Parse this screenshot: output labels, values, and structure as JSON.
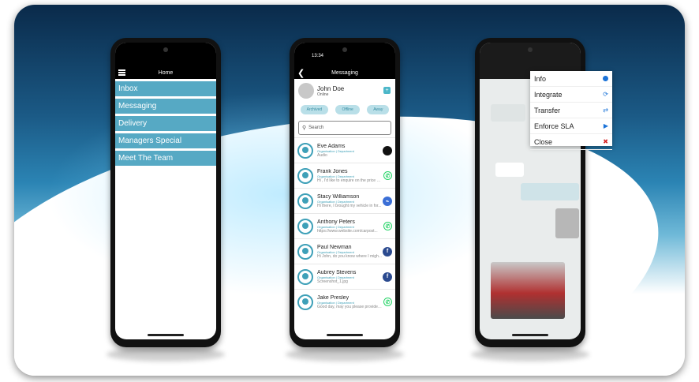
{
  "phone1": {
    "title": "Home",
    "menu": [
      "Inbox",
      "Messaging",
      "Delivery",
      "Managers Special",
      "Meet The Team"
    ]
  },
  "phone2": {
    "time": "13:34",
    "title": "Messaging",
    "contact": {
      "name": "John Doe",
      "status": "Online"
    },
    "filters": [
      "Archived",
      "Offline",
      "Away"
    ],
    "search_placeholder": "Search",
    "chats": [
      {
        "name": "Eve Adams",
        "org": "Organisation | Department",
        "last": "Audio",
        "channel": "black"
      },
      {
        "name": "Frank Jones",
        "org": "Organisation | Department",
        "last": "Hi , I'd like to enquire on the price o...",
        "channel": "whatsapp"
      },
      {
        "name": "Stacy Williamson",
        "org": "Organisation | Department",
        "last": "Hi there, I brought my vehicle in for...",
        "channel": "messenger"
      },
      {
        "name": "Anthony Peters",
        "org": "Organisation | Department",
        "last": "https://www.website.com/carpost...",
        "channel": "whatsapp"
      },
      {
        "name": "Paul Newman",
        "org": "Organisation | Department",
        "last": "Hi John, do you know where I migh...",
        "channel": "facebook"
      },
      {
        "name": "Aubrey Stevens",
        "org": "Organisation | Department",
        "last": "Screenshot_1.jpg",
        "channel": "facebook"
      },
      {
        "name": "Jake Presley",
        "org": "Organisation | Department",
        "last": "Good day, may you please provide ...",
        "channel": "whatsapp"
      }
    ]
  },
  "phone3": {
    "menu": [
      {
        "label": "Info",
        "icon": "info-icon",
        "color": "#1b73d8"
      },
      {
        "label": "Integrate",
        "icon": "sync-icon",
        "color": "#1b73d8"
      },
      {
        "label": "Transfer",
        "icon": "transfer-icon",
        "color": "#1b73d8"
      },
      {
        "label": "Enforce SLA",
        "icon": "play-icon",
        "color": "#1b73d8"
      },
      {
        "label": "Close",
        "icon": "close-icon",
        "color": "#d62222"
      }
    ]
  }
}
